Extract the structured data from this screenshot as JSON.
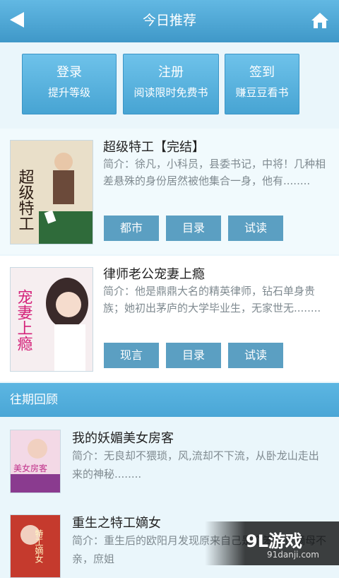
{
  "header": {
    "title": "今日推荐",
    "back_icon": "back-arrow-icon",
    "home_icon": "home-icon"
  },
  "actions": [
    {
      "title": "登录",
      "subtitle": "提升等级"
    },
    {
      "title": "注册",
      "subtitle": "阅读限时免费书"
    },
    {
      "title": "签到",
      "subtitle": "赚豆豆看书"
    }
  ],
  "featured": [
    {
      "title": "超级特工【完结】",
      "desc": "简介：徐凡，小科员，县委书记，中将！几种相差悬殊的身份居然被他集合一身，他有........",
      "cover_text": "超级特工",
      "buttons": [
        "都市",
        "目录",
        "试读"
      ]
    },
    {
      "title": "律师老公宠妻上瘾",
      "desc": "简介：他是鼎鼎大名的精英律师，钻石单身贵族；她初出茅庐的大学毕业生，无家世无........",
      "cover_text": "宠妻上瘾",
      "buttons": [
        "现言",
        "目录",
        "试读"
      ]
    }
  ],
  "section_title": "往期回顾",
  "past": [
    {
      "title": "我的妖媚美女房客",
      "desc": "简介：无良却不猥琐，风,流却不下流，从卧龙山走出来的神秘........",
      "cover_text": "美女房客"
    },
    {
      "title": "重生之特工嫡女",
      "desc": "简介：重生后的欧阳月发现原来自己是个笨蛋！嫡母不亲，庶姐",
      "cover_text": "特工嫡女"
    }
  ],
  "watermark": {
    "brand": "9L游戏",
    "site": "91danji.com"
  },
  "colors": {
    "accent": "#4aa6d6",
    "tag": "#5b9fc2",
    "background": "#eaf6fb"
  }
}
